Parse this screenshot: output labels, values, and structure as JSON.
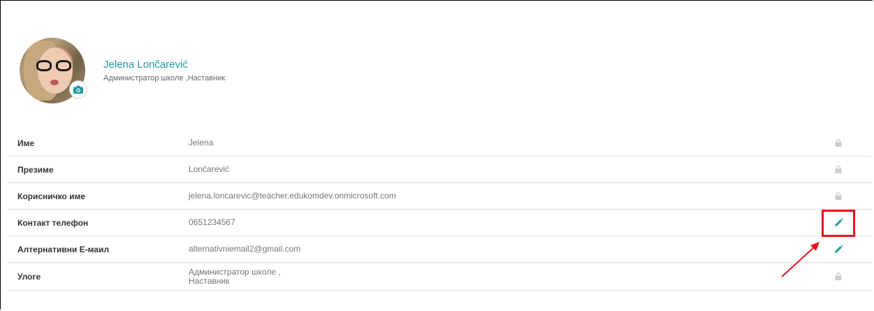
{
  "profile": {
    "name": "Jelena Lončarević",
    "roles": "Администратор школе ,Наставник"
  },
  "fields": [
    {
      "label": "Име",
      "value": "Jelena",
      "action": "lock-icon"
    },
    {
      "label": "Презиме",
      "value": "Lončarević",
      "action": "lock-icon"
    },
    {
      "label": "Корисничко име",
      "value": "jelena.loncarevic@teacher.edukomdev.onmicrosoft.com",
      "action": "lock-icon"
    },
    {
      "label": "Контакт телефон",
      "value": "0651234567",
      "action": "pencil-icon"
    },
    {
      "label": "Алтернативни Е-маил",
      "value": "alternativniemail2@gmail.com",
      "action": "pencil-icon"
    },
    {
      "label": "Улоге",
      "value_lines": [
        "Администратор школе ,",
        "Наставник"
      ],
      "action": "lock-icon"
    }
  ],
  "colors": {
    "accent": "#1f9aa3",
    "highlight": "#e5151b",
    "lock": "#cccccc"
  }
}
